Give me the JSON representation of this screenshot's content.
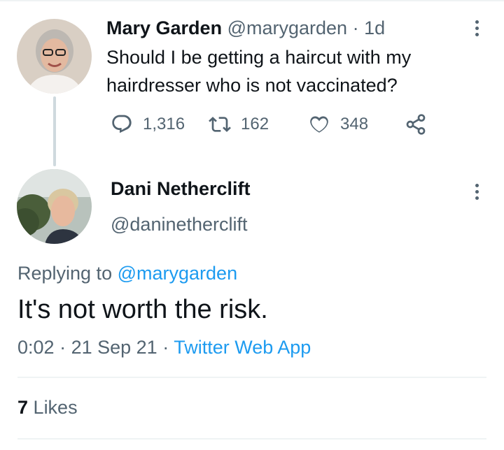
{
  "tweet1": {
    "author_name": "Mary Garden",
    "handle": "@marygarden",
    "separator": "·",
    "time_ago": "1d",
    "text": "Should I be getting a haircut with my hairdresser who is not vaccinated?",
    "replies": "1,316",
    "retweets": "162",
    "likes": "348",
    "icons": [
      "reply-icon",
      "retweet-icon",
      "like-icon",
      "share-icon",
      "more-icon"
    ]
  },
  "tweet2": {
    "author_name": "Dani Netherclift",
    "handle": "@daninetherclift",
    "replying_prefix": "Replying to",
    "replying_handle": "@marygarden",
    "text": "It's not worth the risk.",
    "time": "0:02",
    "separator": "·",
    "date": "21 Sep 21",
    "source": "Twitter Web App",
    "likes_count": "7",
    "likes_label": "Likes"
  },
  "colors": {
    "text": "#0f1419",
    "muted": "#536471",
    "link": "#1d9bf0",
    "divider": "#eff3f4"
  }
}
